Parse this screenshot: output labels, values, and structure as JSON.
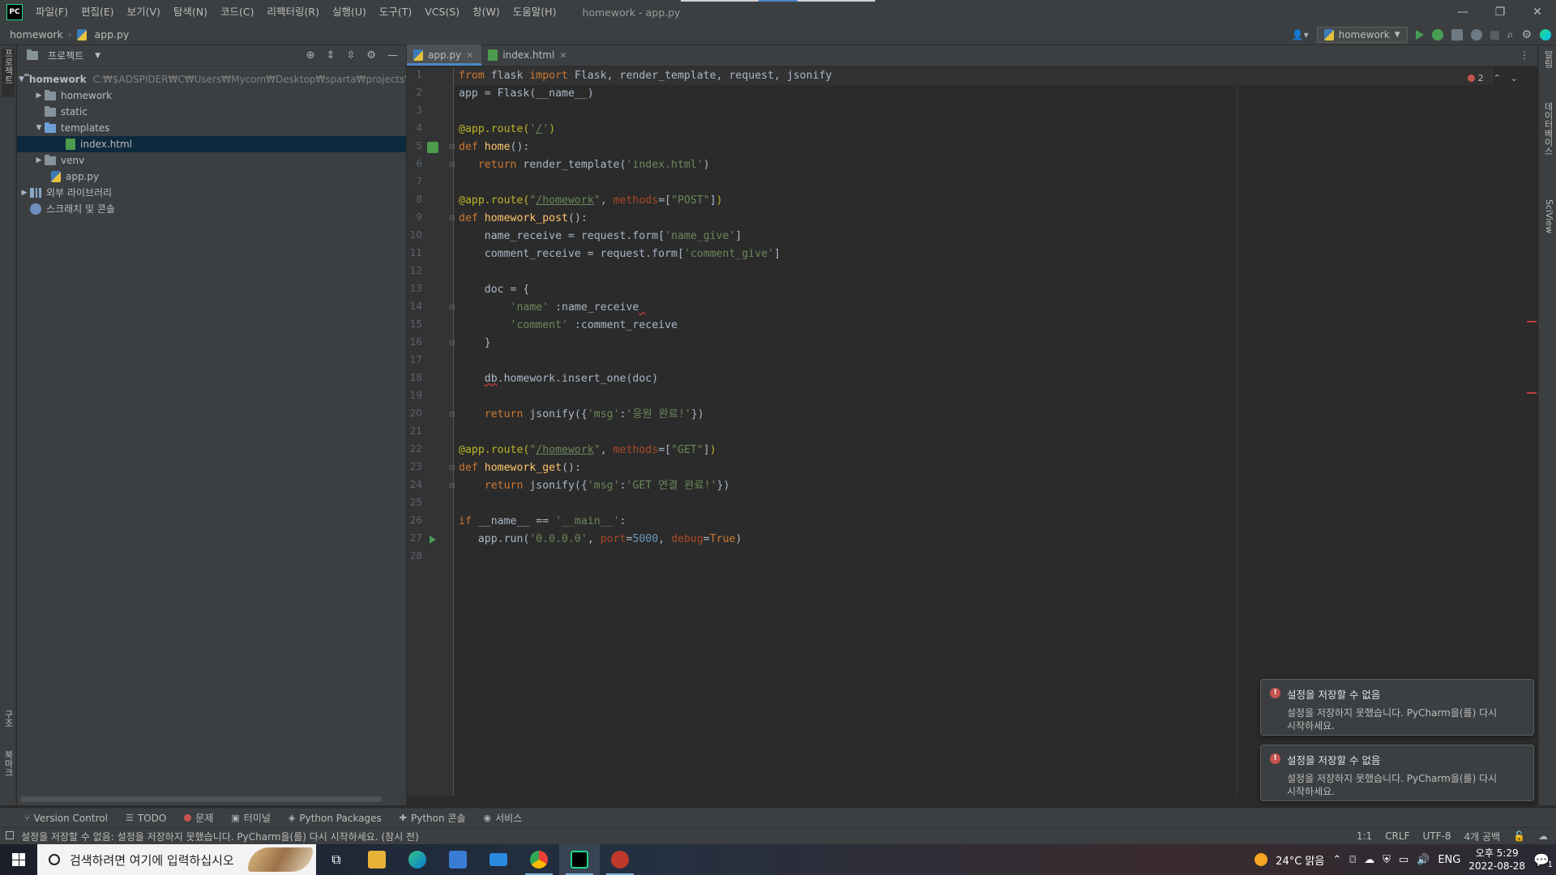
{
  "titlebar": {
    "logo": "PC",
    "menu": [
      "파일(F)",
      "편집(E)",
      "보기(V)",
      "탐색(N)",
      "코드(C)",
      "리팩터링(R)",
      "실행(U)",
      "도구(T)",
      "VCS(S)",
      "창(W)",
      "도움말(H)"
    ],
    "window_title": "homework - app.py",
    "controls": [
      "—",
      "❐",
      "✕"
    ]
  },
  "navbar": {
    "project": "homework",
    "file": "app.py",
    "run_config": "homework"
  },
  "left_strip": {
    "project_tab": "프로젝트",
    "structure_tab": "구조",
    "bookmarks_tab": "북마크"
  },
  "right_strip": {
    "notifications_tab": "알림",
    "database_tab": "데이터베이스",
    "sciview_tab": "SciView"
  },
  "project_panel": {
    "title": "프로젝트",
    "root_name": "homework",
    "root_path": "C:₩$ADSPIDER₩C₩Users₩Mycom₩Desktop₩sparta₩projects₩homework",
    "items": {
      "homework": "homework",
      "static": "static",
      "templates": "templates",
      "index_html": "index.html",
      "venv": "venv",
      "app_py": "app.py",
      "external_libs": "외부 라이브러리",
      "scratches": "스크래치 및 콘솔"
    }
  },
  "tabs": [
    {
      "label": "app.py",
      "active": true
    },
    {
      "label": "index.html",
      "active": false
    }
  ],
  "editor": {
    "error_count": "2",
    "line_numbers": [
      "1",
      "2",
      "3",
      "4",
      "5",
      "6",
      "7",
      "8",
      "9",
      "10",
      "11",
      "12",
      "13",
      "14",
      "15",
      "16",
      "17",
      "18",
      "19",
      "20",
      "21",
      "22",
      "23",
      "24",
      "25",
      "26",
      "27",
      "28"
    ]
  },
  "notifications": [
    {
      "title": "설정을 저장할 수 없음",
      "body": "설정을 저장하지 못했습니다. PyCharm을(를) 다시 시작하세요."
    },
    {
      "title": "설정을 저장할 수 없음",
      "body": "설정을 저장하지 못했습니다. PyCharm을(를) 다시 시작하세요."
    }
  ],
  "tool_windows": [
    "Version Control",
    "TODO",
    "문제",
    "터미널",
    "Python Packages",
    "Python 콘솔",
    "서비스"
  ],
  "statusbar": {
    "message": "설정을 저장할 수 없음: 설정을 저장하지 못했습니다. PyCharm을(를) 다시 시작하세요. (잠시 전)",
    "position": "1:1",
    "line_sep": "CRLF",
    "encoding": "UTF-8",
    "indent": "4개 공백"
  },
  "taskbar": {
    "search_placeholder": "검색하려면 여기에 입력하십시오",
    "weather": "24°C 맑음",
    "lang": "ENG",
    "time": "오후 5:29",
    "date": "2022-08-28",
    "notification_count": "1"
  },
  "colors": {
    "accent": "#4a88c7",
    "error": "#c75450",
    "run_green": "#499c54"
  }
}
